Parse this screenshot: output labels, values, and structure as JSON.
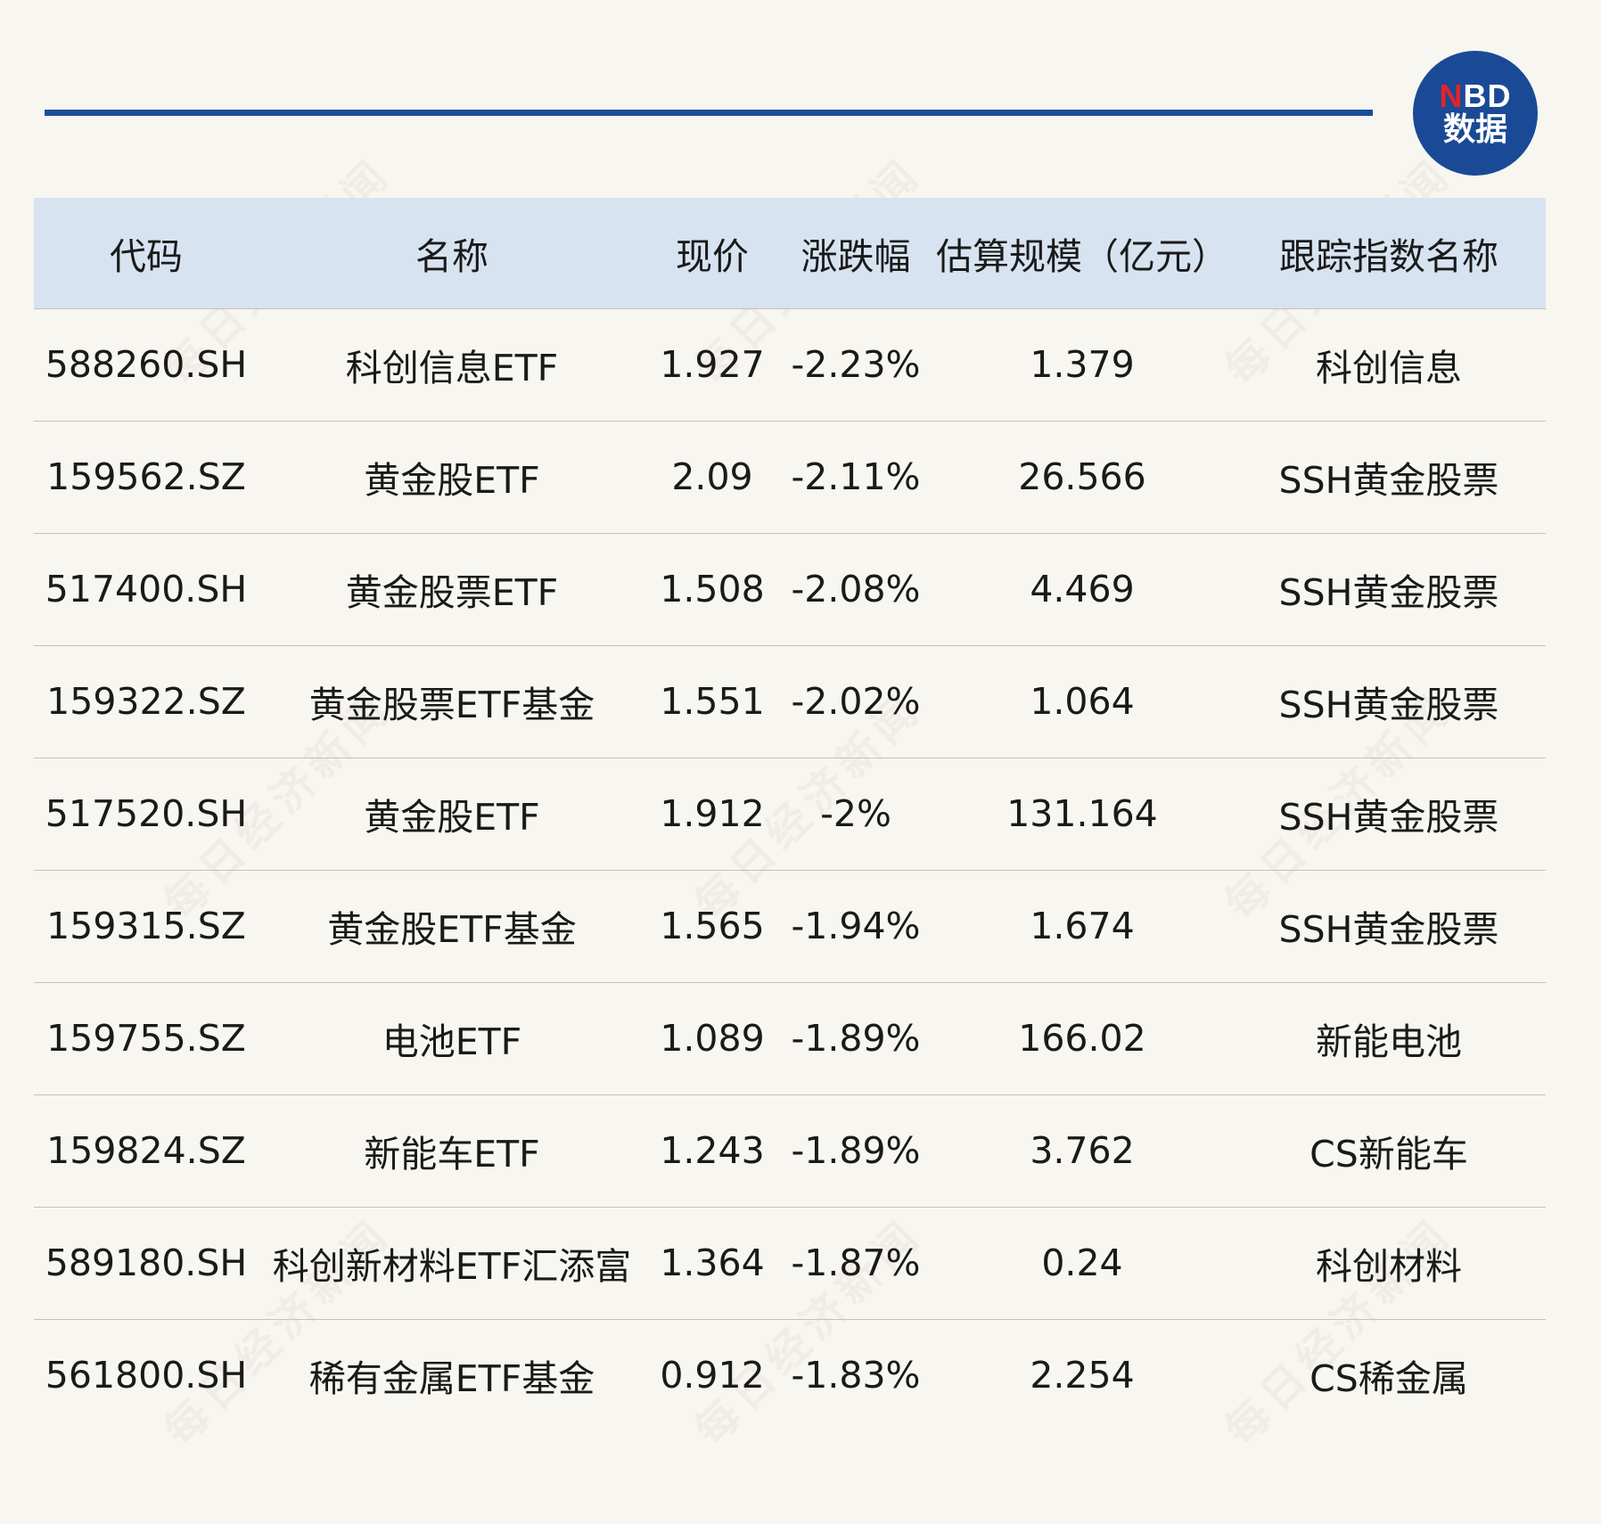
{
  "logo": {
    "line1_red": "N",
    "line1_rest": "BD",
    "line2": "数据"
  },
  "watermark_text": "每日经济新闻",
  "table": {
    "headers": [
      "代码",
      "名称",
      "现价",
      "涨跌幅",
      "估算规模（亿元）",
      "跟踪指数名称"
    ],
    "rows": [
      [
        "588260.SH",
        "科创信息ETF",
        "1.927",
        "-2.23%",
        "1.379",
        "科创信息"
      ],
      [
        "159562.SZ",
        "黄金股ETF",
        "2.09",
        "-2.11%",
        "26.566",
        "SSH黄金股票"
      ],
      [
        "517400.SH",
        "黄金股票ETF",
        "1.508",
        "-2.08%",
        "4.469",
        "SSH黄金股票"
      ],
      [
        "159322.SZ",
        "黄金股票ETF基金",
        "1.551",
        "-2.02%",
        "1.064",
        "SSH黄金股票"
      ],
      [
        "517520.SH",
        "黄金股ETF",
        "1.912",
        "-2%",
        "131.164",
        "SSH黄金股票"
      ],
      [
        "159315.SZ",
        "黄金股ETF基金",
        "1.565",
        "-1.94%",
        "1.674",
        "SSH黄金股票"
      ],
      [
        "159755.SZ",
        "电池ETF",
        "1.089",
        "-1.89%",
        "166.02",
        "新能电池"
      ],
      [
        "159824.SZ",
        "新能车ETF",
        "1.243",
        "-1.89%",
        "3.762",
        "CS新能车"
      ],
      [
        "589180.SH",
        "科创新材料ETF汇添富",
        "1.364",
        "-1.87%",
        "0.24",
        "科创材料"
      ],
      [
        "561800.SH",
        "稀有金属ETF基金",
        "0.912",
        "-1.83%",
        "2.254",
        "CS稀金属"
      ]
    ]
  }
}
